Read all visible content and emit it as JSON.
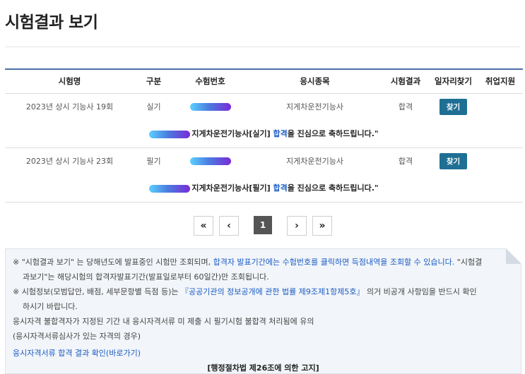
{
  "page": {
    "title": "시험결과 보기"
  },
  "table": {
    "headers": [
      "시험명",
      "구분",
      "수험번호",
      "응시종목",
      "시험결과",
      "일자리찾기",
      "취업지원"
    ],
    "rows": [
      {
        "exam_name": "2023년 상시 기능사 19회",
        "type": "실기",
        "field": "지게차운전기능사",
        "result": "합격",
        "find_label": "찾기",
        "msg_prefix": "지게차운전기능사[실기] ",
        "msg_pass": "합격",
        "msg_suffix": "을 진심으로 축하드립니다.\""
      },
      {
        "exam_name": "2023년 상시 기능사 23회",
        "type": "필기",
        "field": "지게차운전기능사",
        "result": "합격",
        "find_label": "찾기",
        "msg_prefix": "지게차운전기능사[필기] ",
        "msg_pass": "합격",
        "msg_suffix": "을 진심으로 축하드립니다.\""
      }
    ]
  },
  "pagination": {
    "first": "«",
    "prev": "‹",
    "current": "1",
    "next": "›",
    "last": "»"
  },
  "notice": {
    "p1_a": "※ \"시험결과 보기\" 는 당해년도에 발표중인 시험만 조회되며, ",
    "p1_b": "합격자 발표기간에는 수험번호를 클릭하면 득점내역을 조회할 수 있습니다.",
    "p1_c": " \"시험결",
    "p1_d": "과보기\"는 해당시험의 합격자발표기간(발표일로부터 60일간)만 조회됩니다.",
    "p2_a": "※ 시험정보(모범답안, 배점, 세부문항별 득점 등)는 ",
    "p2_b": "『공공기관의 정보공개에 관한 법률 제9조제1항제5호』",
    "p2_c": " 의거 비공개 사항임을 반드시 확인",
    "p2_d": "하시기 바랍니다.",
    "p3": "응시자격 불합격자가 지정된 기간 내 응시자격서류 미 제출 시 필기시험 불합격 처리됨에 유의",
    "p4": "(응시자격서류심사가 있는 자격의 경우)",
    "link": "응시자격서류 합격 결과 확인(바로가기)",
    "footer": "[행정절차법 제26조에 의한 고지]"
  }
}
